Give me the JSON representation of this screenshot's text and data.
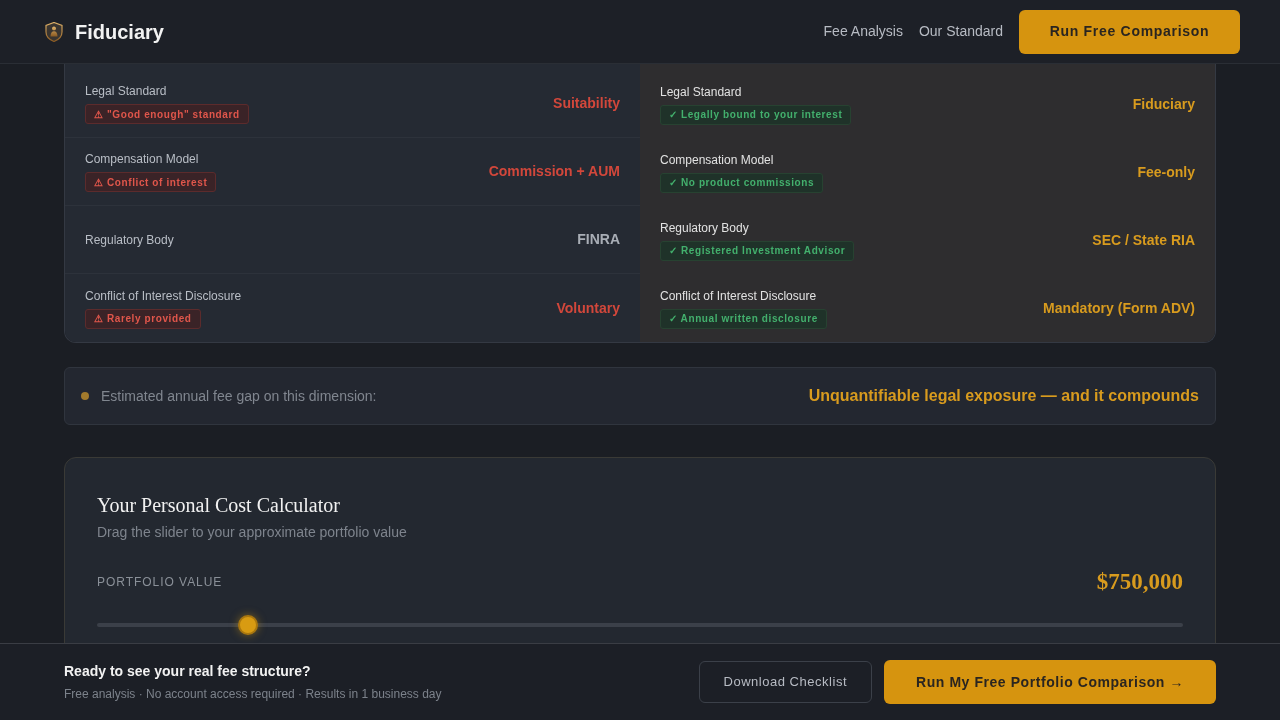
{
  "header": {
    "brand": "Fiduciary",
    "nav": [
      "Fee Analysis",
      "Our Standard"
    ],
    "cta": "Run Free Comparison"
  },
  "comparison": {
    "columns": [
      {
        "kind": "broker",
        "rows": [
          {
            "label": "Legal Standard",
            "badge": {
              "kind": "warning",
              "text": "⚠ \"Good enough\" standard"
            },
            "value": "Suitability",
            "color": "#d2473b"
          },
          {
            "label": "Compensation Model",
            "badge": {
              "kind": "warning",
              "text": "⚠ Conflict of interest"
            },
            "value": "Commission + AUM",
            "color": "#d2473b"
          },
          {
            "label": "Regulatory Body",
            "value": "FINRA",
            "color": "#a9aeb6"
          },
          {
            "label": "Conflict of Interest Disclosure",
            "badge": {
              "kind": "warning",
              "text": "⚠ Rarely provided"
            },
            "value": "Voluntary",
            "color": "#d2473b"
          }
        ]
      },
      {
        "kind": "fiduciary",
        "rows": [
          {
            "label": "Legal Standard",
            "badge": {
              "kind": "check",
              "text": "✓ Legally bound to your interest"
            },
            "value": "Fiduciary",
            "color": "#d89b1e"
          },
          {
            "label": "Compensation Model",
            "badge": {
              "kind": "check",
              "text": "✓ No product commissions"
            },
            "value": "Fee-only",
            "color": "#d89b1e"
          },
          {
            "label": "Regulatory Body",
            "badge": {
              "kind": "check",
              "text": "✓ Registered Investment Advisor"
            },
            "value": "SEC / State RIA",
            "color": "#d89b1e"
          },
          {
            "label": "Conflict of Interest Disclosure",
            "badge": {
              "kind": "check",
              "text": "✓ Annual written disclosure"
            },
            "value": "Mandatory (Form ADV)",
            "color": "#d89b1e"
          }
        ]
      }
    ]
  },
  "fee_gap": {
    "label": "Estimated annual fee gap on this dimension:",
    "value": "Unquantifiable legal exposure — and it compounds"
  },
  "calculator": {
    "title": "Your Personal Cost Calculator",
    "subtitle": "Drag the slider to your approximate portfolio value",
    "field_label": "PORTFOLIO VALUE",
    "value": "$750,000",
    "slider": {
      "level": 0.139
    }
  },
  "footer": {
    "title": "Ready to see your real fee structure?",
    "subtitle": "Free analysis · No account access required · Results in 1 business day",
    "buttons": [
      {
        "kind": "secondary",
        "label": "Download Checklist"
      },
      {
        "kind": "primary",
        "label": "Run My Free Portfolio Comparison →"
      }
    ]
  }
}
